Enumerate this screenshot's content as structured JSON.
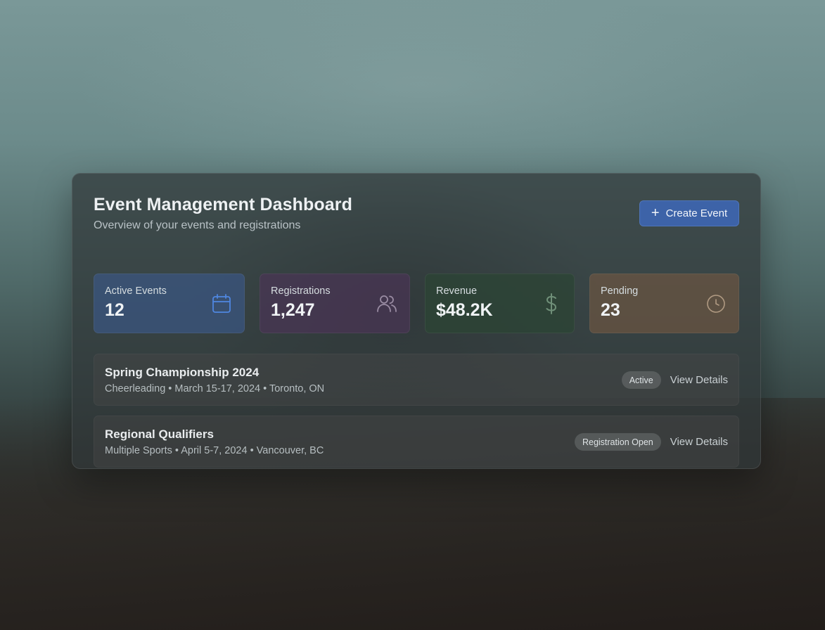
{
  "dashboard": {
    "title": "Event Management Dashboard",
    "subtitle": "Overview of your events and registrations",
    "create_button_label": "Create Event"
  },
  "stats": [
    {
      "label": "Active Events",
      "value": "12",
      "icon": "calendar-icon",
      "color": "#3a5682"
    },
    {
      "label": "Registrations",
      "value": "1,247",
      "icon": "users-icon",
      "color": "#4a3454"
    },
    {
      "label": "Revenue",
      "value": "$48.2K",
      "icon": "dollar-icon",
      "color": "#2c4434"
    },
    {
      "label": "Pending",
      "value": "23",
      "icon": "clock-icon",
      "color": "#6c5642"
    }
  ],
  "events": [
    {
      "name": "Spring Championship 2024",
      "meta": "Cheerleading • March 15-17, 2024 • Toronto, ON",
      "status": "Active",
      "action": "View Details"
    },
    {
      "name": "Regional Qualifiers",
      "meta": "Multiple Sports • April 5-7, 2024 • Vancouver, BC",
      "status": "Registration Open",
      "action": "View Details"
    }
  ],
  "colors": {
    "accent": "#3d63a8"
  }
}
